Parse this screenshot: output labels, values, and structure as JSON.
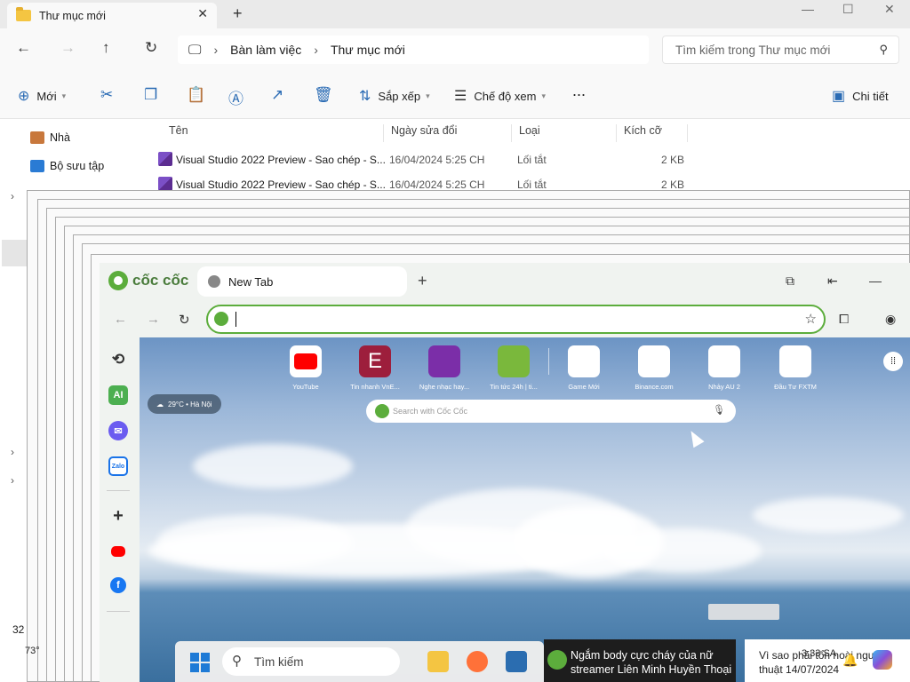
{
  "explorer": {
    "tab_title": "Thư mục mới",
    "breadcrumb": [
      "Bàn làm việc",
      "Thư mục mới"
    ],
    "search_placeholder": "Tìm kiếm trong Thư mục mới",
    "commands": {
      "new": "Mới",
      "sort": "Sắp xếp",
      "view": "Chế độ xem",
      "more": "...",
      "details": "Chi tiết"
    },
    "columns": [
      "Tên",
      "Ngày sửa đổi",
      "Loại",
      "Kích cỡ"
    ],
    "files": [
      {
        "name": "Visual Studio 2022 Preview - Sao chép - S...",
        "date": "16/04/2024 5:25 CH",
        "type": "Lối tắt",
        "size": "2 KB"
      },
      {
        "name": "Visual Studio 2022 Preview - Sao chép - S...",
        "date": "16/04/2024 5:25 CH",
        "type": "Lối tắt",
        "size": "2 KB"
      }
    ],
    "sidebar": [
      {
        "label": "Nhà",
        "icon": "home-icon"
      },
      {
        "label": "Bộ sưu tập",
        "icon": "gallery-icon"
      }
    ],
    "status_partial": "32 m"
  },
  "browser": {
    "brand": "cốc cốc",
    "tab_title": "New Tab",
    "address_value": "",
    "weather": "29°C • Hà Nội",
    "search_placeholder": "Search with Cốc Cốc",
    "speed_dials": [
      {
        "label": "YouTube",
        "color": "#ffffff"
      },
      {
        "label": "Tin nhanh VnE...",
        "color": "#9d1e3c"
      },
      {
        "label": "Nghe nhạc hay...",
        "color": "#7b2ea8"
      },
      {
        "label": "Tin tức 24h | ti...",
        "color": "#7ab83c"
      },
      {
        "label": "Game Mới",
        "color": "#ffffff"
      },
      {
        "label": "Binance.com",
        "color": "#ffffff"
      },
      {
        "label": "Nhảy AU 2",
        "color": "#ffffff"
      },
      {
        "label": "Đầu Tư FXTM",
        "color": "#ffffff"
      }
    ],
    "left_icons": [
      "history-icon",
      "ai-icon",
      "messenger-icon",
      "zalo-icon",
      "add-icon",
      "youtube-icon",
      "facebook-icon"
    ],
    "ai_label": "AI",
    "zalo_label": "Zalo"
  },
  "taskbar": {
    "temp": "73°",
    "search_label": "Tìm kiếm",
    "news_text": "Ngắm body cực cháy của nữ streamer Liên Minh Huyền Thoại",
    "tray_line1": "Vì sao phải tổn hoài ngư",
    "tray_line2": "thuật 14/07/2024",
    "time_partial": "3:33 SA"
  }
}
